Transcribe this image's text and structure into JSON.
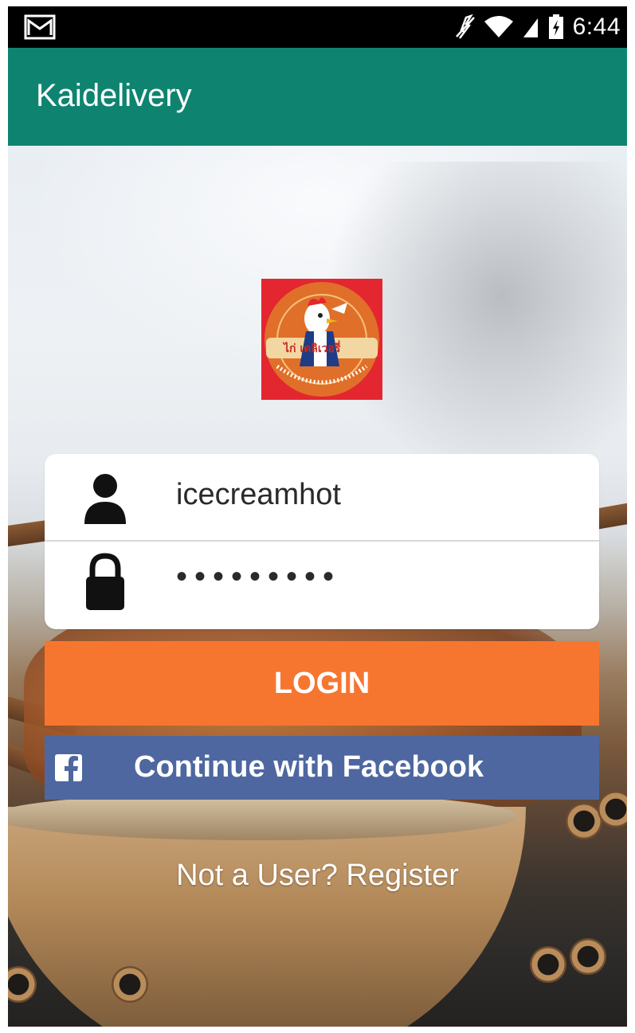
{
  "status_bar": {
    "time": "6:44",
    "icons": [
      "gmail-icon",
      "mute-icon",
      "wifi-icon",
      "signal-icon",
      "battery-charging-icon"
    ]
  },
  "app_bar": {
    "title": "Kaidelivery",
    "color": "#0e8470"
  },
  "logo": {
    "text_main": "ไก่ เดลิเวอรี่",
    "background_color": "#e3262f"
  },
  "login_form": {
    "username": {
      "icon": "user-icon",
      "value": "icecreamhot"
    },
    "password": {
      "icon": "lock-icon",
      "value": "•••••••••"
    }
  },
  "buttons": {
    "login_label": "LOGIN",
    "login_color": "#f7762f",
    "facebook_label": "Continue with Facebook",
    "facebook_icon": "facebook-icon",
    "facebook_color": "#4e67a0"
  },
  "register": {
    "label": "Not a User? Register"
  }
}
